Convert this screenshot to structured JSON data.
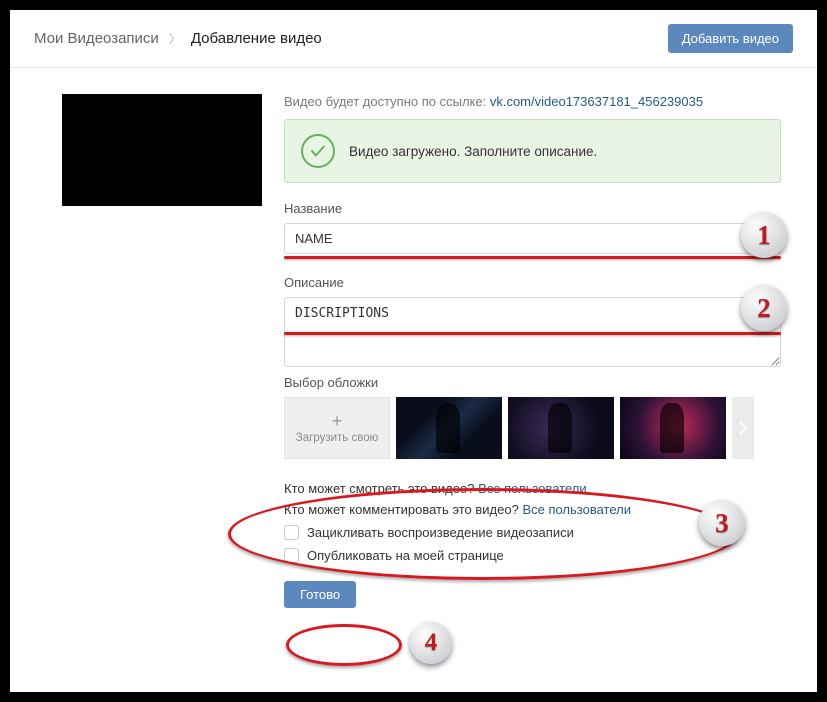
{
  "header": {
    "breadcrumb_root": "Мои Видеозаписи",
    "breadcrumb_current": "Добавление видео",
    "add_button": "Добавить видео"
  },
  "link_row": {
    "prefix": "Видео будет доступно по ссылке: ",
    "url": "vk.com/video173637181_456239035"
  },
  "success": {
    "message": "Видео загружено. Заполните описание."
  },
  "title_field": {
    "label": "Название",
    "value": "NAME"
  },
  "desc_field": {
    "label": "Описание",
    "value": "DISCRIPTIONS"
  },
  "cover": {
    "label": "Выбор обложки",
    "upload_label": "Загрузить свою"
  },
  "privacy": {
    "view_q": "Кто может смотреть это видео? ",
    "view_a": "Все пользователи",
    "comment_q": "Кто может комментировать это видео? ",
    "comment_a": "Все пользователи"
  },
  "checkboxes": {
    "loop": "Зацикливать воспроизведение видеозаписи",
    "publish": "Опубликовать на моей странице"
  },
  "done_button": "Готово",
  "annotations": {
    "b1": "1",
    "b2": "2",
    "b3": "3",
    "b4": "4"
  }
}
